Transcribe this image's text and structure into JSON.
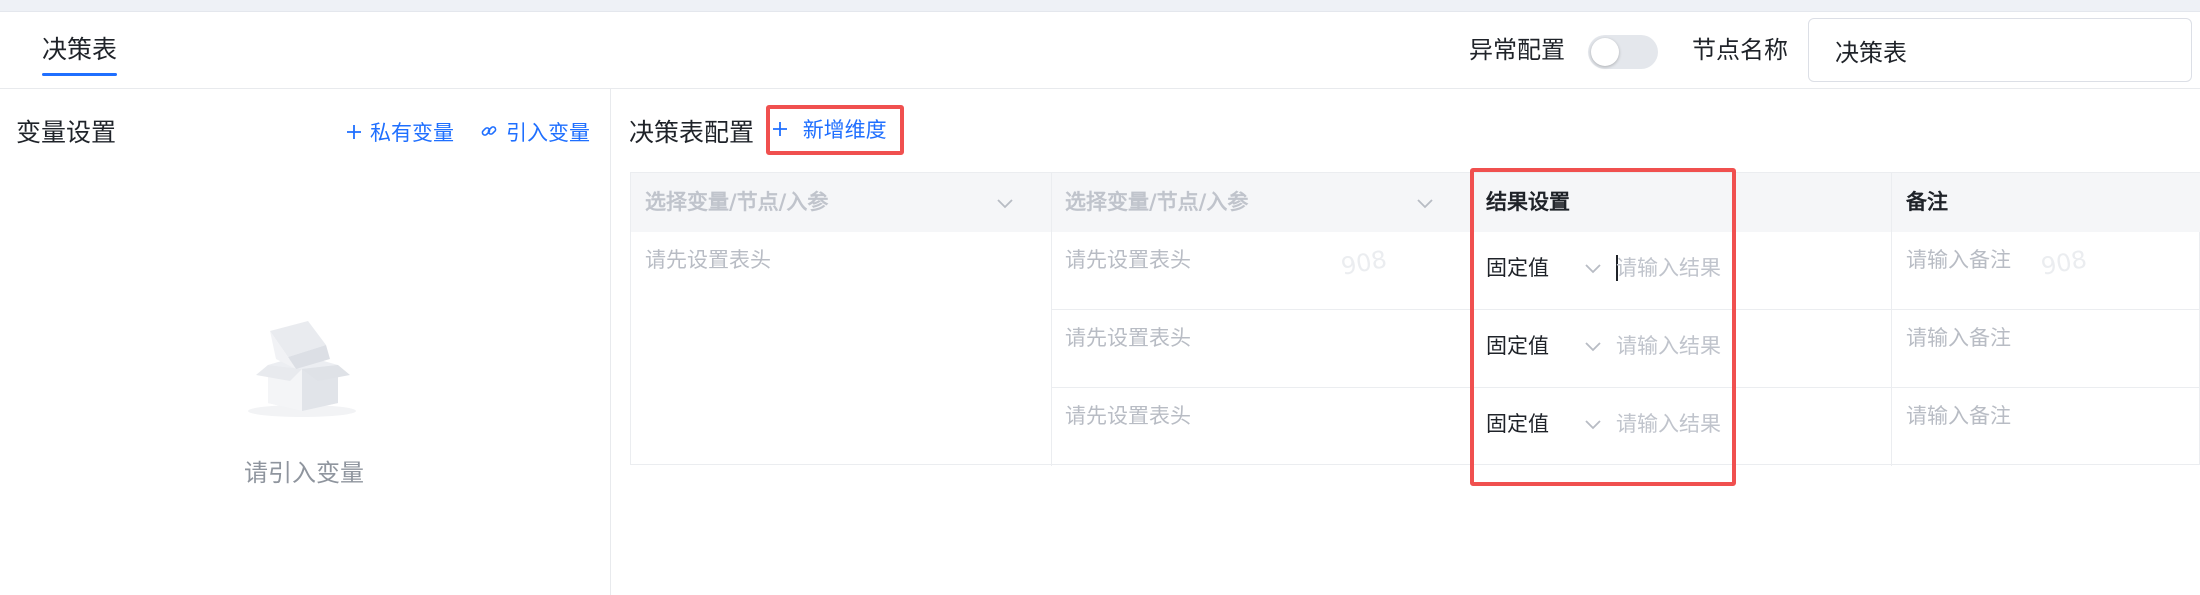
{
  "header": {
    "tab_label": "决策表",
    "abnormal_label": "异常配置",
    "abnormal_enabled": false,
    "node_name_label": "节点名称",
    "node_name_value": "决策表"
  },
  "left_panel": {
    "title": "变量设置",
    "private_var_button": "私有变量",
    "import_var_button": "引入变量",
    "empty_text": "请引入变量"
  },
  "main": {
    "title": "决策表配置",
    "add_dimension_button": "新增维度",
    "table": {
      "headers": [
        "选择变量/节点/入参",
        "选择变量/节点/入参",
        "结果设置",
        "备注"
      ],
      "col1_placeholder": "请先设置表头",
      "rows": [
        {
          "col2": "请先设置表头",
          "fixed": "固定值",
          "result_placeholder": "请输入结果",
          "note": "请输入备注"
        },
        {
          "col2": "请先设置表头",
          "fixed": "固定值",
          "result_placeholder": "请输入结果",
          "note": "请输入备注"
        },
        {
          "col2": "请先设置表头",
          "fixed": "固定值",
          "result_placeholder": "请输入结果",
          "note": "请输入备注"
        }
      ],
      "watermarks": [
        "908",
        "908"
      ]
    }
  },
  "colors": {
    "accent": "#1f6fff",
    "highlight": "#f0504f"
  }
}
